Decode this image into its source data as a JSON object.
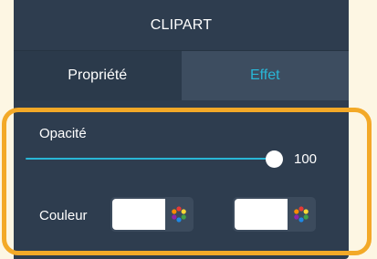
{
  "panel": {
    "title": "CLIPART"
  },
  "tabs": [
    {
      "label": "Propriété",
      "active": false
    },
    {
      "label": "Effet",
      "active": true
    }
  ],
  "opacity": {
    "label": "Opacité",
    "value": "100",
    "fraction": 1.0
  },
  "color": {
    "label": "Couleur",
    "swatches": [
      {
        "color": "#ffffff",
        "picker_icon": "color-wheel-icon"
      },
      {
        "color": "#ffffff",
        "picker_icon": "color-wheel-icon"
      }
    ]
  },
  "colors": {
    "panel_bg": "#2e3d4f",
    "accent": "#29b6d6",
    "highlight": "#f3a928"
  }
}
